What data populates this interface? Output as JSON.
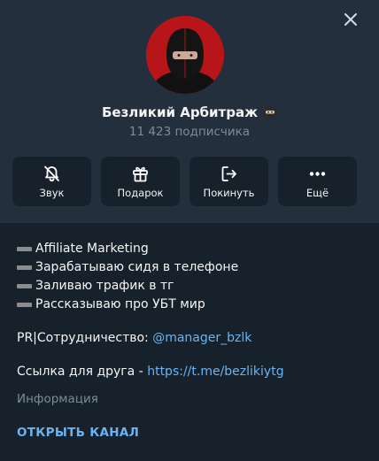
{
  "channel": {
    "name": "Безликий Арбитраж",
    "subscribers": "11 423 подписчика"
  },
  "actions": [
    {
      "label": "Звук",
      "icon": "bell-mute-icon"
    },
    {
      "label": "Подарок",
      "icon": "gift-icon"
    },
    {
      "label": "Покинуть",
      "icon": "leave-icon"
    },
    {
      "label": "Ещё",
      "icon": "more-icon"
    }
  ],
  "description": {
    "items": [
      "Affiliate Marketing",
      "Зарабатываю сидя в телефоне",
      "Заливаю трафик в тг",
      "Рассказываю про УБТ мир"
    ],
    "pr_prefix": "PR|Сотрудничество: ",
    "pr_handle": "@manager_bzlk",
    "friend_prefix": "Ссылка для друга - ",
    "friend_link": "https://t.me/bezlikiytg"
  },
  "info_label": "Информация",
  "open_channel": "ОТКРЫТЬ КАНАЛ",
  "colors": {
    "background": "#17212b",
    "header": "#242f3d",
    "accent": "#6ab3f3",
    "muted": "#7d8b99"
  }
}
